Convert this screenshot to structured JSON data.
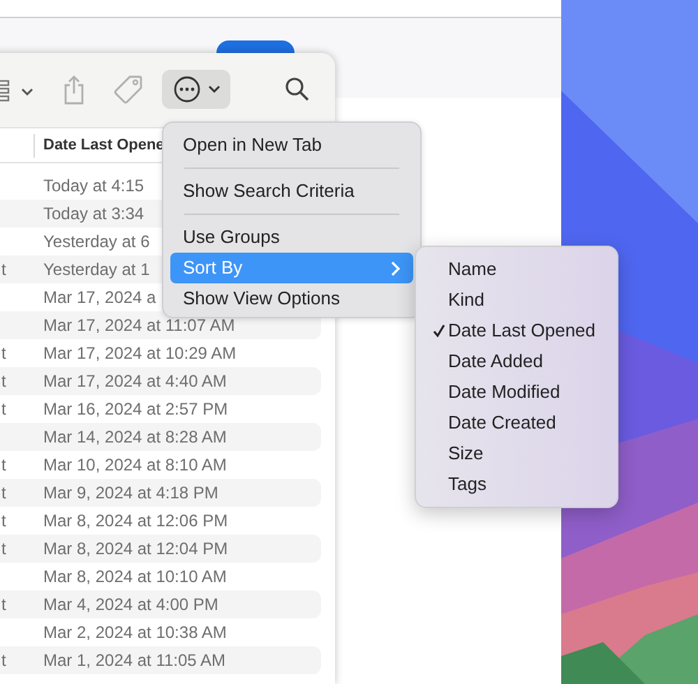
{
  "column_header": "Date Last Opene",
  "rows": [
    {
      "date_last_opened": "Today at 4:15"
    },
    {
      "date_last_opened": "Today at 3:34"
    },
    {
      "date_last_opened": "Yesterday at 6"
    },
    {
      "name_fragment": "t",
      "date_last_opened": "Yesterday at 1"
    },
    {
      "date_last_opened": "Mar 17, 2024 a"
    },
    {
      "date_last_opened": "Mar 17, 2024 at 11:07 AM"
    },
    {
      "name_fragment": "t",
      "date_last_opened": "Mar 17, 2024 at 10:29 AM"
    },
    {
      "name_fragment": "t",
      "date_last_opened": "Mar 17, 2024 at 4:40 AM"
    },
    {
      "name_fragment": "t",
      "date_last_opened": "Mar 16, 2024 at 2:57 PM"
    },
    {
      "date_last_opened": "Mar 14, 2024 at 8:28 AM"
    },
    {
      "name_fragment": "t",
      "date_last_opened": "Mar 10, 2024 at 8:10 AM"
    },
    {
      "name_fragment": "t",
      "date_last_opened": "Mar 9, 2024 at 4:18 PM"
    },
    {
      "name_fragment": "t",
      "date_last_opened": "Mar 8, 2024 at 12:06 PM"
    },
    {
      "name_fragment": "t",
      "date_last_opened": "Mar 8, 2024 at 12:04 PM"
    },
    {
      "date_last_opened": "Mar 8, 2024 at 10:10 AM"
    },
    {
      "name_fragment": "t",
      "date_last_opened": "Mar 4, 2024 at 4:00 PM"
    },
    {
      "date_last_opened": "Mar 2, 2024 at 10:38 AM"
    },
    {
      "name_fragment": "t",
      "date_last_opened": "Mar 1, 2024 at 11:05 AM"
    }
  ],
  "menu": {
    "items": [
      {
        "kind": "item",
        "label": "Open in New Tab",
        "selected": false
      },
      {
        "kind": "separator"
      },
      {
        "kind": "item",
        "label": "Show Search Criteria",
        "selected": false
      },
      {
        "kind": "separator"
      },
      {
        "kind": "item",
        "label": "Use Groups",
        "selected": false
      },
      {
        "kind": "submenu",
        "label": "Sort By",
        "selected": true
      },
      {
        "kind": "item",
        "label": "Show View Options",
        "selected": false
      }
    ]
  },
  "submenu": {
    "items": [
      {
        "label": "Name",
        "checked": false
      },
      {
        "label": "Kind",
        "checked": false
      },
      {
        "label": "Date Last Opened",
        "checked": true
      },
      {
        "label": "Date Added",
        "checked": false
      },
      {
        "label": "Date Modified",
        "checked": false
      },
      {
        "label": "Date Created",
        "checked": false
      },
      {
        "label": "Size",
        "checked": false
      },
      {
        "label": "Tags",
        "checked": false
      }
    ]
  }
}
